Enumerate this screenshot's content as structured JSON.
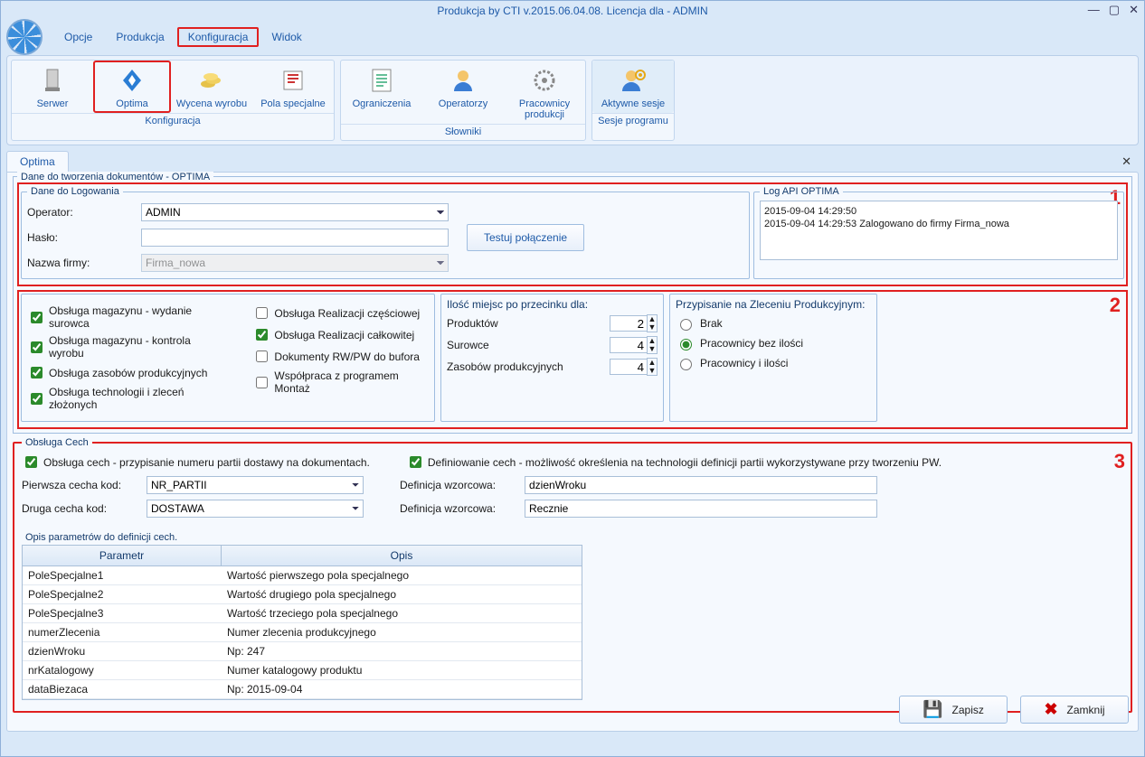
{
  "window_title": "Produkcja by CTI v.2015.06.04.08. Licencja dla  - ADMIN",
  "menu": [
    "Opcje",
    "Produkcja",
    "Konfiguracja",
    "Widok"
  ],
  "ribbon": {
    "groups": [
      {
        "label": "Konfiguracja",
        "items": [
          {
            "name": "serwer-button",
            "label": "Serwer"
          },
          {
            "name": "optima-button",
            "label": "Optima",
            "hl": true
          },
          {
            "name": "wycena-button",
            "label": "Wycena wyrobu"
          },
          {
            "name": "pola-button",
            "label": "Pola specjalne"
          }
        ]
      },
      {
        "label": "Słowniki",
        "items": [
          {
            "name": "ogran-button",
            "label": "Ograniczenia"
          },
          {
            "name": "oper-button",
            "label": "Operatorzy"
          },
          {
            "name": "pracprod-button",
            "label": "Pracownicy produkcji"
          }
        ]
      },
      {
        "label": "Sesje programu",
        "items": [
          {
            "name": "sesje-button",
            "label": "Aktywne sesje",
            "cls": "sessions"
          }
        ]
      }
    ]
  },
  "content_tab": "Optima",
  "fs_outer_title": "Dane do tworzenia dokumentów - OPTIMA",
  "login": {
    "legend": "Dane do Logowania",
    "operator_label": "Operator:",
    "operator_value": "ADMIN",
    "haslo_label": "Hasło:",
    "haslo_value": "",
    "nazwa_label": "Nazwa firmy:",
    "nazwa_value": "Firma_nowa",
    "test_btn": "Testuj połączenie"
  },
  "log": {
    "legend": "Log API OPTIMA",
    "lines": [
      "2015-09-04 14:29:50",
      "2015-09-04 14:29:53 Zalogowano do firmy Firma_nowa"
    ]
  },
  "section2": {
    "col1": [
      {
        "checked": true,
        "label": "Obsługa magazynu - wydanie surowca"
      },
      {
        "checked": true,
        "label": "Obsługa magazynu - kontrola wyrobu"
      },
      {
        "checked": true,
        "label": "Obsługa zasobów produkcyjnych"
      },
      {
        "checked": true,
        "label": "Obsługa technologii i zleceń złożonych"
      }
    ],
    "col2": [
      {
        "checked": false,
        "label": "Obsługa Realizacji częściowej"
      },
      {
        "checked": true,
        "label": "Obsługa Realizacji całkowitej"
      },
      {
        "checked": false,
        "label": "Dokumenty RW/PW do bufora"
      },
      {
        "checked": false,
        "label": "Współpraca z programem Montaż"
      }
    ],
    "decimals": {
      "legend": "Ilość miejsc po przecinku dla:",
      "rows": [
        {
          "label": "Produktów",
          "value": "2"
        },
        {
          "label": "Surowce",
          "value": "4"
        },
        {
          "label": "Zasobów produkcyjnych",
          "value": "4"
        }
      ]
    },
    "przypisanie": {
      "legend": "Przypisanie na Zleceniu Produkcyjnym:",
      "options": [
        {
          "label": "Brak",
          "sel": false
        },
        {
          "label": "Pracownicy bez ilości",
          "sel": true
        },
        {
          "label": "Pracownicy i ilości",
          "sel": false
        }
      ]
    }
  },
  "cech": {
    "legend": "Obsługa Cech",
    "chk1_label": "Obsługa cech - przypisanie numeru partii dostawy na dokumentach.",
    "chk2_label": "Definiowanie cech - możliwość określenia na technologii definicji partii wykorzystywane przy tworzeniu PW.",
    "p1_label": "Pierwsza cecha kod:",
    "p1_value": "NR_PARTII",
    "p2_label": "Druga cecha kod:",
    "p2_value": "DOSTAWA",
    "d1_label": "Definicja wzorcowa:",
    "d1_value": "dzienWroku",
    "d2_label": "Definicja wzorcowa:",
    "d2_value": "Recznie"
  },
  "params": {
    "legend": "Opis parametrów do definicji cech.",
    "col_param": "Parametr",
    "col_opis": "Opis",
    "rows": [
      {
        "p": "PoleSpecjalne1",
        "o": "Wartość pierwszego pola specjalnego"
      },
      {
        "p": "PoleSpecjalne2",
        "o": "Wartość drugiego pola specjalnego"
      },
      {
        "p": "PoleSpecjalne3",
        "o": "Wartość trzeciego pola specjalnego"
      },
      {
        "p": "numerZlecenia",
        "o": "Numer zlecenia produkcyjnego"
      },
      {
        "p": "dzienWroku",
        "o": "Np: 247"
      },
      {
        "p": "nrKatalogowy",
        "o": "Numer katalogowy produktu"
      },
      {
        "p": "dataBiezaca",
        "o": "Np: 2015-09-04"
      }
    ]
  },
  "footer": {
    "save": "Zapisz",
    "close": "Zamknij"
  },
  "annotations": [
    "1",
    "2",
    "3"
  ]
}
